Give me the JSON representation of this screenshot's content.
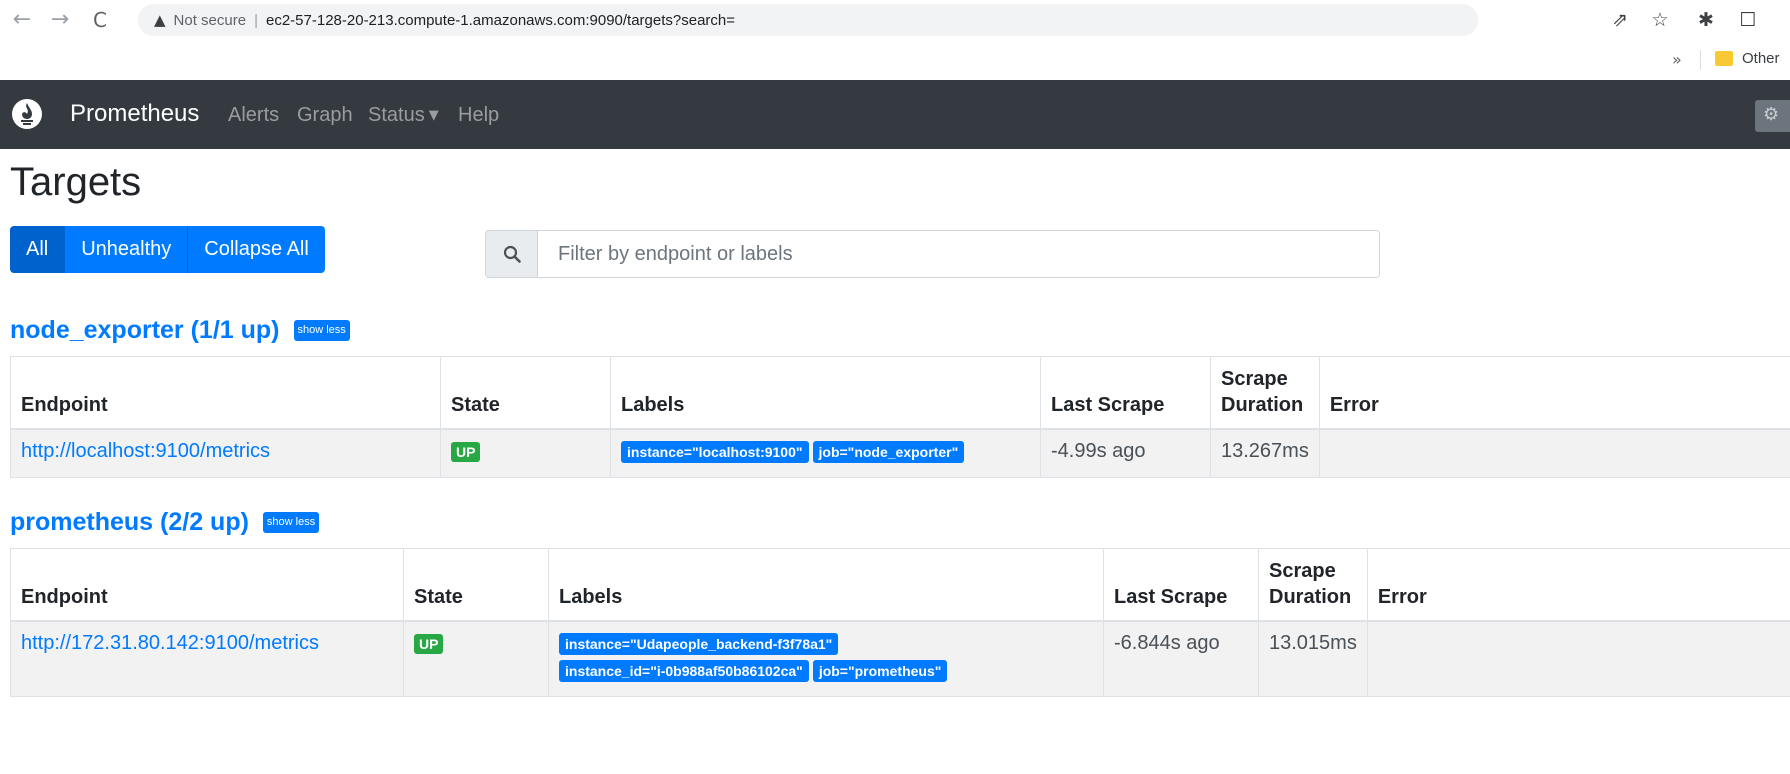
{
  "browser": {
    "not_secure": "Not secure",
    "separator": "|",
    "url": "ec2-57-128-20-213.compute-1.amazonaws.com:9090/targets?search=",
    "bookmarks_more": "»",
    "bookmarks_folder": "Other"
  },
  "navbar": {
    "brand": "Prometheus",
    "links": [
      "Alerts",
      "Graph",
      "Status",
      "Help"
    ]
  },
  "page": {
    "title": "Targets",
    "filters": [
      "All",
      "Unhealthy",
      "Collapse All"
    ],
    "search": {
      "placeholder": "Filter by endpoint or labels",
      "value": ""
    }
  },
  "columns": {
    "endpoint": "Endpoint",
    "state": "State",
    "labels": "Labels",
    "last_scrape": "Last Scrape",
    "scrape": "Scrape",
    "duration": "Duration",
    "error": "Error"
  },
  "pools": [
    {
      "title": "node_exporter (1/1 up)",
      "toggle": "show less",
      "rows": [
        {
          "endpoint": "http://localhost:9100/metrics",
          "state": "UP",
          "labels": [
            "instance=\"localhost:9100\"",
            "job=\"node_exporter\""
          ],
          "last_scrape": "-4.99s ago",
          "duration": "13.267ms",
          "error": ""
        }
      ]
    },
    {
      "title": "prometheus (2/2 up)",
      "toggle": "show less",
      "rows": [
        {
          "endpoint": "http://172.31.80.142:9100/metrics",
          "state": "UP",
          "labels": [
            "instance=\"Udapeople_backend-f3f78a1\"",
            "instance_id=\"i-0b988af50b86102ca\"",
            "job=\"prometheus\""
          ],
          "last_scrape": "-6.844s ago",
          "duration": "13.015ms",
          "error": ""
        }
      ]
    }
  ],
  "colors": {
    "navbar": "#343a40",
    "primary": "#007bff",
    "success": "#28a745"
  }
}
